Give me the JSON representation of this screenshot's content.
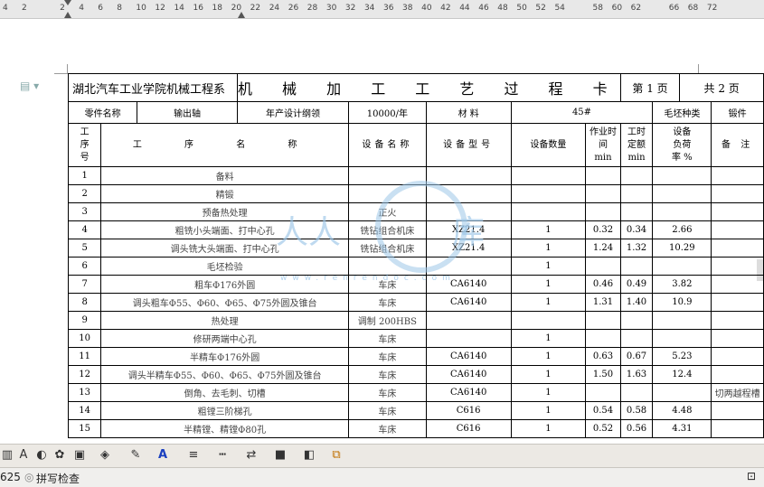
{
  "ruler": {
    "ticks": [
      "4",
      "2",
      "",
      "2",
      "4",
      "6",
      "8",
      "10",
      "12",
      "14",
      "16",
      "18",
      "20",
      "22",
      "24",
      "26",
      "28",
      "30",
      "32",
      "34",
      "36",
      "38",
      "40",
      "42",
      "44",
      "46",
      "48",
      "50",
      "52",
      "54",
      "",
      "58",
      "60",
      "62",
      "",
      "66",
      "68",
      "72"
    ]
  },
  "card": {
    "school": "湖北汽车工业学院机械工程系",
    "title": "机 械 加 工 工 艺 过 程 卡",
    "page_label": "第 1 页",
    "total_label": "共 2 页",
    "part_name_label": "零件名称",
    "part_name": "输出轴",
    "annual_output_label": "年产设计纲领",
    "annual_output": "10000/年",
    "material_label": "材 料",
    "material": "45#",
    "blank_type_label": "毛坯种类",
    "blank_type": "锻件",
    "columns": {
      "proc_no": "工序号",
      "proc_name": "工 序 名 称",
      "equip_name": "设备名称",
      "equip_model": "设备型号",
      "equip_qty": "设备数量",
      "work_time": "作业时间 min",
      "quota_time": "工时定额 min",
      "load_rate": "设备负荷率 %",
      "remark": "备 注"
    },
    "rows": [
      {
        "no": "1",
        "name": "备料",
        "equip": "",
        "model": "",
        "qty": "",
        "wt": "",
        "qt": "",
        "load": "",
        "remark": ""
      },
      {
        "no": "2",
        "name": "精锻",
        "equip": "",
        "model": "",
        "qty": "",
        "wt": "",
        "qt": "",
        "load": "",
        "remark": ""
      },
      {
        "no": "3",
        "name": "预备热处理",
        "equip": "正火",
        "model": "",
        "qty": "",
        "wt": "",
        "qt": "",
        "load": "",
        "remark": ""
      },
      {
        "no": "4",
        "name": "粗铣小头端面、打中心孔",
        "equip": "铣钻组合机床",
        "model": "XZ21.4",
        "qty": "1",
        "wt": "0.32",
        "qt": "0.34",
        "load": "2.66",
        "remark": ""
      },
      {
        "no": "5",
        "name": "调头铣大头端面、打中心孔",
        "equip": "铣钻组合机床",
        "model": "XZ21.4",
        "qty": "1",
        "wt": "1.24",
        "qt": "1.32",
        "load": "10.29",
        "remark": ""
      },
      {
        "no": "6",
        "name": "毛坯检验",
        "equip": "",
        "model": "",
        "qty": "1",
        "wt": "",
        "qt": "",
        "load": "",
        "remark": ""
      },
      {
        "no": "7",
        "name": "粗车Φ176外圆",
        "equip": "车床",
        "model": "CA6140",
        "qty": "1",
        "wt": "0.46",
        "qt": "0.49",
        "load": "3.82",
        "remark": ""
      },
      {
        "no": "8",
        "name": "调头粗车Φ55、Φ60、Φ65、Φ75外圆及锥台",
        "equip": "车床",
        "model": "CA6140",
        "qty": "1",
        "wt": "1.31",
        "qt": "1.40",
        "load": "10.9",
        "remark": ""
      },
      {
        "no": "9",
        "name": "热处理",
        "equip": "调制 200HBS",
        "model": "",
        "qty": "",
        "wt": "",
        "qt": "",
        "load": "",
        "remark": ""
      },
      {
        "no": "10",
        "name": "修研两端中心孔",
        "equip": "车床",
        "model": "",
        "qty": "1",
        "wt": "",
        "qt": "",
        "load": "",
        "remark": ""
      },
      {
        "no": "11",
        "name": "半精车Φ176外圆",
        "equip": "车床",
        "model": "CA6140",
        "qty": "1",
        "wt": "0.63",
        "qt": "0.67",
        "load": "5.23",
        "remark": ""
      },
      {
        "no": "12",
        "name": "调头半精车Φ55、Φ60、Φ65、Φ75外圆及锥台",
        "equip": "车床",
        "model": "CA6140",
        "qty": "1",
        "wt": "1.50",
        "qt": "1.63",
        "load": "12.4",
        "remark": ""
      },
      {
        "no": "13",
        "name": "倒角、去毛刺、切槽",
        "equip": "车床",
        "model": "CA6140",
        "qty": "1",
        "wt": "",
        "qt": "",
        "load": "",
        "remark": "切两越程槽"
      },
      {
        "no": "14",
        "name": "粗镗三阶梯孔",
        "equip": "车床",
        "model": "C616",
        "qty": "1",
        "wt": "0.54",
        "qt": "0.58",
        "load": "4.48",
        "remark": ""
      },
      {
        "no": "15",
        "name": "半精镗、精镗Φ80孔",
        "equip": "车床",
        "model": "C616",
        "qty": "1",
        "wt": "0.52",
        "qt": "0.56",
        "load": "4.31",
        "remark": ""
      }
    ]
  },
  "watermark": {
    "text_left": "人人",
    "text_right": "库",
    "url": "www.renrendoc.com"
  },
  "status": {
    "page_count": "625",
    "spell_check": "拼写检查"
  }
}
